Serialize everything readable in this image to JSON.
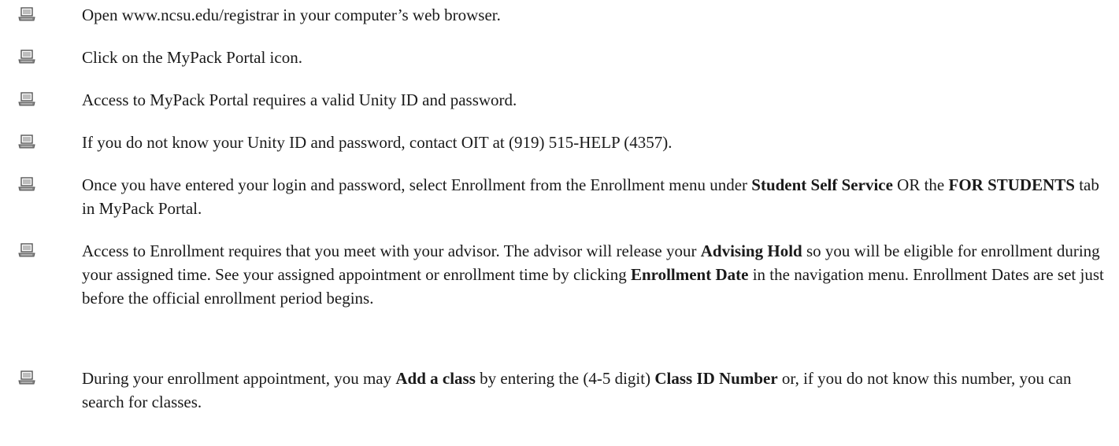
{
  "icon": "laptop-icon",
  "items": [
    {
      "parts": [
        {
          "t": "Open www.ncsu.edu/registrar in your computer’s web browser."
        }
      ]
    },
    {
      "parts": [
        {
          "t": "Click on the MyPack Portal icon."
        }
      ]
    },
    {
      "parts": [
        {
          "t": "Access to MyPack Portal requires a valid Unity ID and password."
        }
      ]
    },
    {
      "parts": [
        {
          "t": "If you do not know your Unity ID and password, contact OIT at (919) 515-HELP (4357)."
        }
      ]
    },
    {
      "parts": [
        {
          "t": "Once you have entered your login and password, select Enrollment from the Enrollment menu under "
        },
        {
          "t": "Student Self Service",
          "b": true
        },
        {
          "t": " OR the "
        },
        {
          "t": "FOR STUDENTS",
          "b": true
        },
        {
          "t": " tab in MyPack Portal."
        }
      ]
    },
    {
      "parts": [
        {
          "t": "Access to Enrollment requires that you meet with your advisor. The advisor will release your "
        },
        {
          "t": "Advising Hold",
          "b": true
        },
        {
          "t": " so you will be eligible for enrollment during your assigned time. See your assigned appointment or enrollment time by clicking "
        },
        {
          "t": "Enrollment Date",
          "b": true
        },
        {
          "t": " in the navigation menu. Enrollment Dates are set just before the official enrollment period begins."
        }
      ]
    },
    {
      "parts": [
        {
          "t": "During your enrollment appointment, you may "
        },
        {
          "t": "Add a class",
          "b": true
        },
        {
          "t": " by entering the (4-5 digit) "
        },
        {
          "t": "Class ID Number",
          "b": true
        },
        {
          "t": " or, if you do not know this number, you can search for classes."
        }
      ]
    }
  ]
}
